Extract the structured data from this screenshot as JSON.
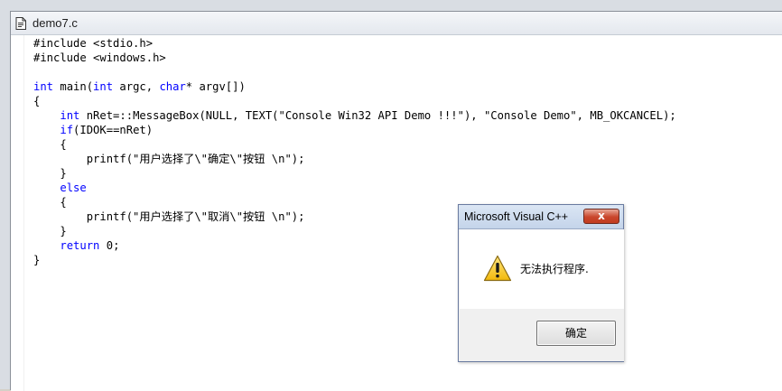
{
  "document": {
    "title": "demo7.c",
    "code_lines": [
      [
        {
          "t": "#include <stdio.h>",
          "k": false
        }
      ],
      [
        {
          "t": "#include <windows.h>",
          "k": false
        }
      ],
      [
        {
          "t": "",
          "k": false
        }
      ],
      [
        {
          "t": "int",
          "k": true
        },
        {
          "t": " main(",
          "k": false
        },
        {
          "t": "int",
          "k": true
        },
        {
          "t": " argc, ",
          "k": false
        },
        {
          "t": "char",
          "k": true
        },
        {
          "t": "* argv[])",
          "k": false
        }
      ],
      [
        {
          "t": "{",
          "k": false
        }
      ],
      [
        {
          "t": "    ",
          "k": false
        },
        {
          "t": "int",
          "k": true
        },
        {
          "t": " nRet=::MessageBox(NULL, TEXT(\"Console Win32 API Demo !!!\"), \"Console Demo\", MB_OKCANCEL);",
          "k": false
        }
      ],
      [
        {
          "t": "    ",
          "k": false
        },
        {
          "t": "if",
          "k": true
        },
        {
          "t": "(IDOK==nRet)",
          "k": false
        }
      ],
      [
        {
          "t": "    {",
          "k": false
        }
      ],
      [
        {
          "t": "        printf(\"用户选择了\\\"确定\\\"按钮 \\n\");",
          "k": false
        }
      ],
      [
        {
          "t": "    }",
          "k": false
        }
      ],
      [
        {
          "t": "    ",
          "k": false
        },
        {
          "t": "else",
          "k": true
        }
      ],
      [
        {
          "t": "    {",
          "k": false
        }
      ],
      [
        {
          "t": "        printf(\"用户选择了\\\"取消\\\"按钮 \\n\");",
          "k": false
        }
      ],
      [
        {
          "t": "    }",
          "k": false
        }
      ],
      [
        {
          "t": "    ",
          "k": false
        },
        {
          "t": "return",
          "k": true
        },
        {
          "t": " 0;",
          "k": false
        }
      ],
      [
        {
          "t": "}",
          "k": false
        }
      ]
    ]
  },
  "dialog": {
    "title": "Microsoft Visual C++",
    "close_label": "x",
    "message": "无法执行程序.",
    "ok_label": "确定"
  },
  "colors": {
    "keyword": "#0000ff",
    "text": "#000000"
  }
}
